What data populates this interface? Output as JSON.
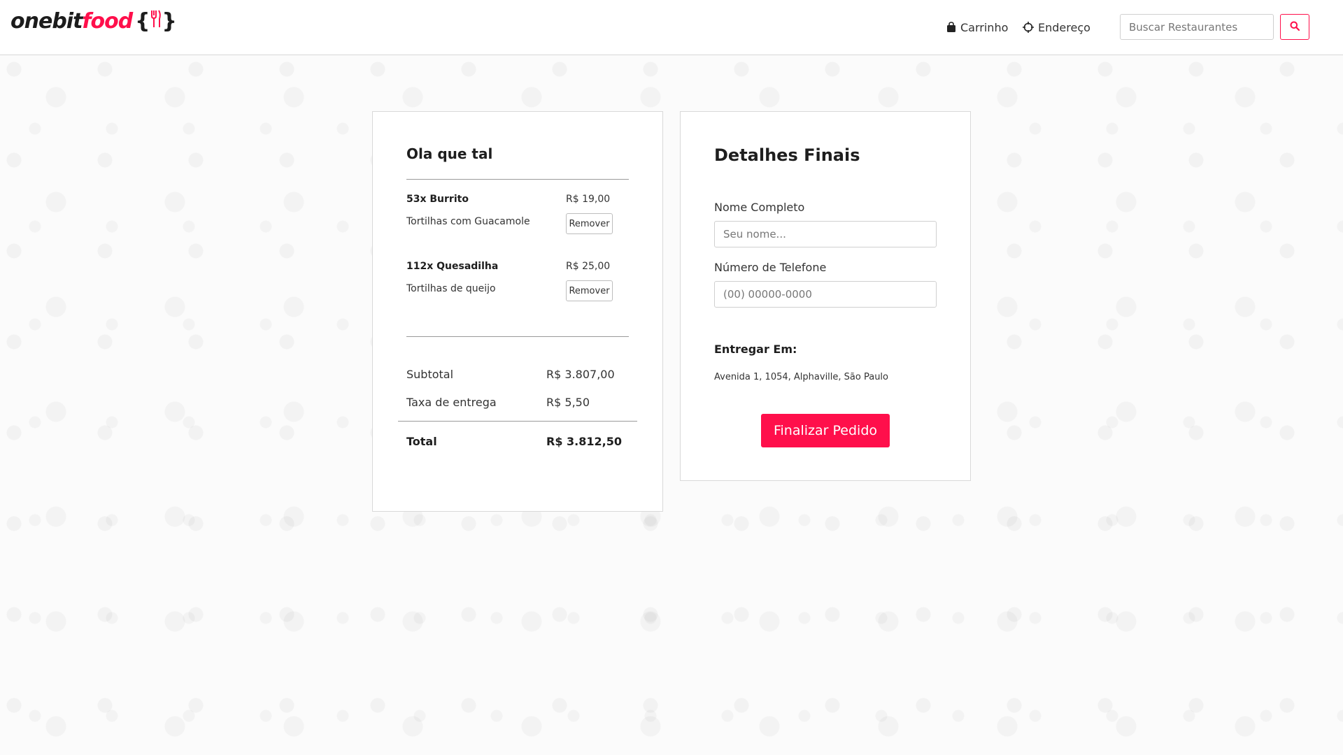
{
  "header": {
    "logo": {
      "part1": "onebit",
      "part2": "food",
      "brace_open": "{",
      "brace_close": "}"
    },
    "nav": {
      "cart_label": "Carrinho",
      "cart_icon": "shopping-bag-icon",
      "address_label": "Endereço",
      "address_icon": "crosshair-icon"
    },
    "search": {
      "placeholder": "Buscar Restaurantes",
      "value": "",
      "button_icon": "search-icon"
    }
  },
  "order": {
    "title": "Ola que tal",
    "items": [
      {
        "name": "53x Burrito",
        "description": "Tortilhas com Guacamole",
        "price": "R$ 19,00",
        "remove_label": "Remover"
      },
      {
        "name": "112x Quesadilha",
        "description": "Tortilhas de queijo",
        "price": "R$ 25,00",
        "remove_label": "Remover"
      }
    ],
    "subtotal_label": "Subtotal",
    "subtotal_value": "R$ 3.807,00",
    "delivery_label": "Taxa de entrega",
    "delivery_value": "R$ 5,50",
    "total_label": "Total",
    "total_value": "R$ 3.812,50"
  },
  "details": {
    "title": "Detalhes Finais",
    "name_label": "Nome Completo",
    "name_placeholder": "Seu nome...",
    "name_value": "",
    "phone_label": "Número de Telefone",
    "phone_placeholder": "(00) 00000-0000",
    "phone_value": "",
    "deliver_label": "Entregar Em:",
    "deliver_address": "Avenida 1, 1054, Alphaville, São Paulo",
    "submit_label": "Finalizar Pedido"
  },
  "colors": {
    "accent": "#ff0f4b",
    "text_dark": "#1e1e1e",
    "border": "#d9d9d9"
  }
}
